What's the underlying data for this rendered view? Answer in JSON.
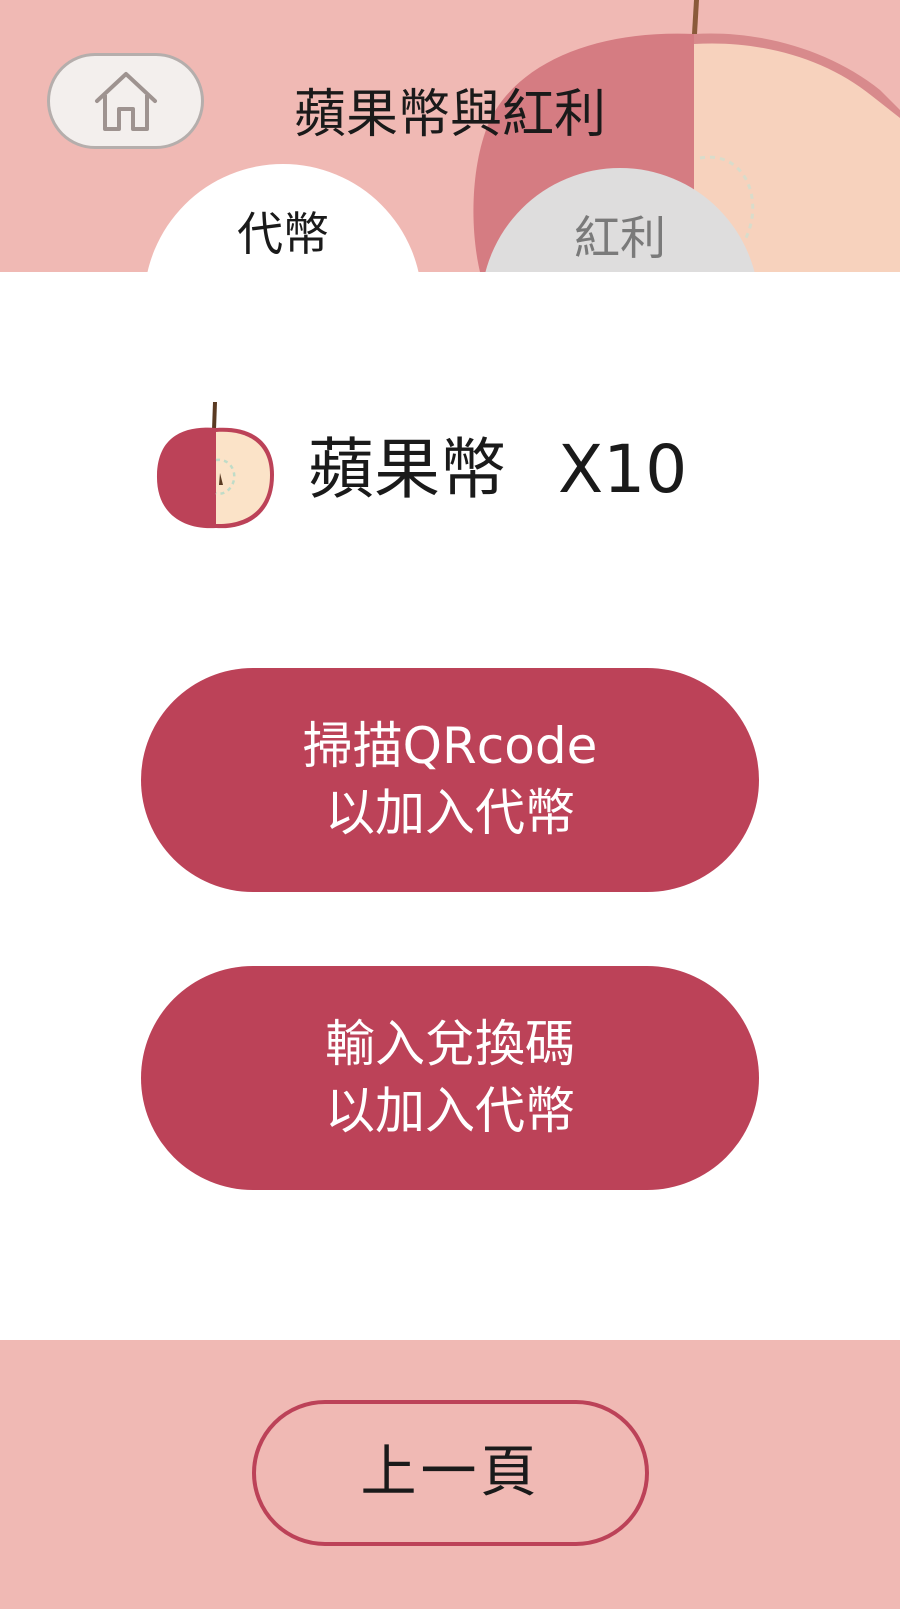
{
  "header": {
    "title": "蘋果幣與紅利",
    "home_icon": "home-icon"
  },
  "tabs": [
    {
      "label": "代幣",
      "active": true
    },
    {
      "label": "紅利",
      "active": false
    }
  ],
  "coin": {
    "icon": "apple-icon",
    "label": "蘋果幣",
    "count": "X10"
  },
  "actions": {
    "scan": {
      "line1": "掃描QRcode",
      "line2": "以加入代幣"
    },
    "redeem": {
      "line1": "輸入兌換碼",
      "line2": "以加入代幣"
    }
  },
  "footer": {
    "back_label": "上一頁"
  },
  "colors": {
    "header_bg": "#f0b9b4",
    "accent": "#bc4258",
    "apple_flesh": "#f7d2bd",
    "apple_skin": "#d57c82",
    "inactive_tab": "#dedddd"
  }
}
